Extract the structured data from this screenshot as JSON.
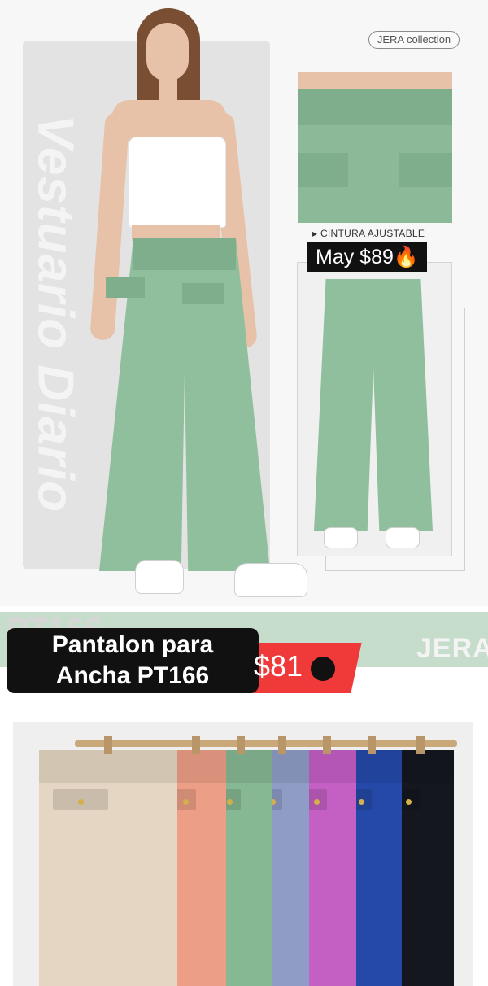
{
  "top": {
    "side_text": "Vestuario Diario",
    "brand_badge": "JERA collection",
    "detail_label": "▸ CINTURA AJUSTABLE",
    "may_price": "May $89🔥"
  },
  "bottom": {
    "watermark_pt": "PT166",
    "watermark_brand": "JERA",
    "title_line1": "Pantalon para",
    "title_line2": "Ancha PT166",
    "price": "$81"
  },
  "colors": {
    "main_green": "#8fbf9c",
    "price_red": "#f03a3a",
    "swatches": [
      "#e4d6c2",
      "#ec9e86",
      "#86b894",
      "#8e9cc6",
      "#c45fc4",
      "#2449a8",
      "#15171f"
    ]
  },
  "swatch_names": [
    "beige",
    "salmon",
    "mint-green",
    "periwinkle",
    "magenta",
    "royal-blue",
    "black"
  ]
}
